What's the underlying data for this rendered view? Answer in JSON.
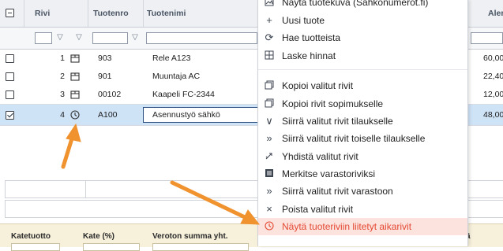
{
  "grid": {
    "headers": {
      "rivi": "Rivi",
      "tuotenro": "Tuotenro",
      "tuotenimi": "Tuotenimi",
      "right": "Aler"
    },
    "rows": [
      {
        "num": "1",
        "code": "903",
        "name": "Rele A123",
        "price": "60,00",
        "checked": false,
        "icon": "package-icon"
      },
      {
        "num": "2",
        "code": "901",
        "name": "Muuntaja AC",
        "price": "22,40",
        "checked": false,
        "icon": "package-icon"
      },
      {
        "num": "3",
        "code": "00102",
        "name": "Kaapeli FC-2344",
        "price": "12,00",
        "checked": false,
        "icon": "package-icon"
      },
      {
        "num": "4",
        "code": "A100",
        "name": "Asennustyö sähkö",
        "price": "48,00",
        "checked": true,
        "icon": "clock-icon"
      }
    ]
  },
  "summary": {
    "katetuotto": "Katetuotto",
    "kate": "Kate (%)",
    "veroton": "Veroton summa yht.",
    "right_partial": "ä"
  },
  "context_menu": {
    "items": [
      {
        "label": "Näytä tuotekuva (Sähkonumerot.fi)",
        "icon": "image-icon"
      },
      {
        "label": "Uusi tuote",
        "icon": "plus-icon"
      },
      {
        "label": "Hae tuotteista",
        "icon": "refresh-icon"
      },
      {
        "label": "Laske hinnat",
        "icon": "calculator-icon"
      },
      {
        "label": "Kopioi valitut rivit",
        "icon": "copy-icon"
      },
      {
        "label": "Kopioi rivit sopimukselle",
        "icon": "copy-icon"
      },
      {
        "label": "Siirrä valitut rivit tilaukselle",
        "icon": "chevron-down-icon"
      },
      {
        "label": "Siirrä valitut rivit toiselle tilaukselle",
        "icon": "double-chevron-right-icon"
      },
      {
        "label": "Yhdistä valitut rivit",
        "icon": "merge-icon"
      },
      {
        "label": "Merkitse varastoriviksi",
        "icon": "warehouse-icon"
      },
      {
        "label": "Siirrä valitut rivit varastoon",
        "icon": "double-chevron-right-icon"
      },
      {
        "label": "Poista valitut rivit",
        "icon": "close-icon"
      },
      {
        "label": "Näytä tuoteriviin liitetyt aikarivit",
        "icon": "clock-icon"
      }
    ],
    "highlight_color": "#e34a33"
  },
  "colors": {
    "selected_row": "#cfe3f7",
    "arrow": "#f0922e",
    "summary_bg": "#f7f1dc"
  }
}
